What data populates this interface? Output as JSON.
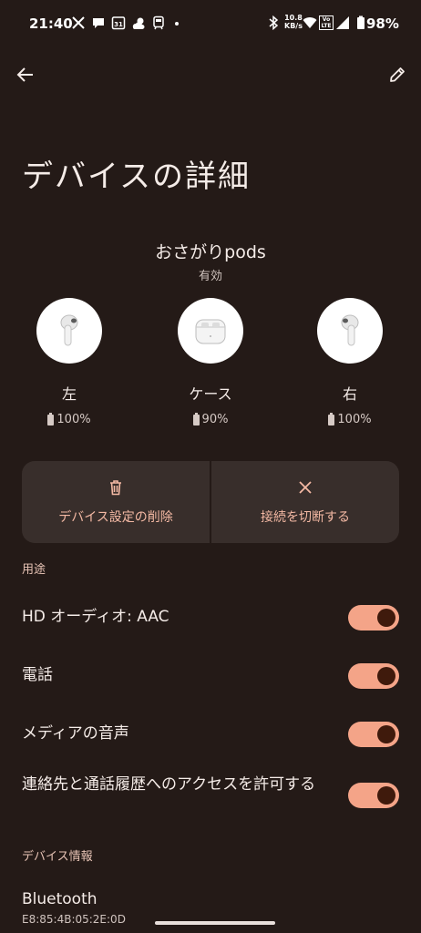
{
  "status_bar": {
    "time": "21:40",
    "net_speed_value": "10.8",
    "net_speed_unit": "KB/s",
    "volte": "Vo LTE",
    "calendar_date": "31",
    "battery": "98%",
    "icons": [
      "x-icon",
      "chat-icon",
      "calendar-icon",
      "weather-icon",
      "transit-icon",
      "bluetooth-icon",
      "wifi-icon",
      "signal-icon",
      "battery-icon"
    ]
  },
  "app_bar": {
    "back_icon": "arrow-back-icon",
    "edit_icon": "pencil-icon"
  },
  "page": {
    "title": "デバイスの詳細"
  },
  "device": {
    "name": "おさがりpods",
    "status": "有効",
    "components": [
      {
        "label": "左",
        "battery": "100%"
      },
      {
        "label": "ケース",
        "battery": "90%"
      },
      {
        "label": "右",
        "battery": "100%"
      }
    ]
  },
  "actions": {
    "forget_label": "デバイス設定の削除",
    "disconnect_label": "接続を切断する"
  },
  "usage": {
    "header": "用途",
    "items": [
      {
        "label": "HD オーディオ: AAC",
        "enabled": true
      },
      {
        "label": "電話",
        "enabled": true
      },
      {
        "label": "メディアの音声",
        "enabled": true
      },
      {
        "label": "連絡先と通話履歴へのアクセスを許可する",
        "enabled": true
      }
    ]
  },
  "device_info": {
    "header": "デバイス情報",
    "bluetooth_label": "Bluetooth",
    "bluetooth_address": "E8:85:4B:05:2E:0D"
  },
  "colors": {
    "background": "#241a17",
    "accent": "#f4a488",
    "card": "#382e2b",
    "section_header": "#e8c4b6"
  }
}
